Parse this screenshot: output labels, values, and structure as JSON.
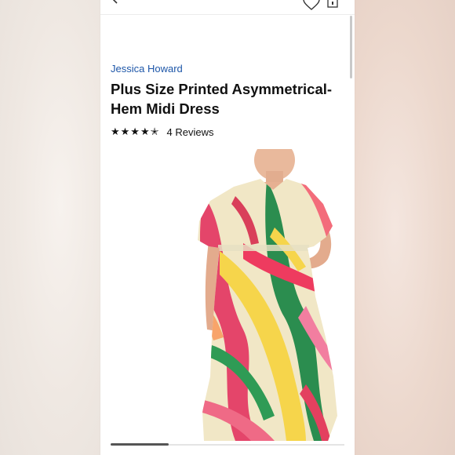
{
  "header": {
    "back_icon": "chevron-left-icon",
    "wishlist_icon": "heart-icon",
    "bag_icon": "shopping-bag-icon"
  },
  "product": {
    "brand": "Jessica Howard",
    "title": "Plus Size Printed Asymmetrical-Hem Midi Dress",
    "rating": 4.5,
    "stars_text": "★★★★✭",
    "reviews_label": "4 Reviews"
  },
  "gallery": {
    "image_description": "product-photo",
    "position_fraction": 0.25
  },
  "colors": {
    "brand_link": "#1d56a8",
    "text": "#111111"
  }
}
